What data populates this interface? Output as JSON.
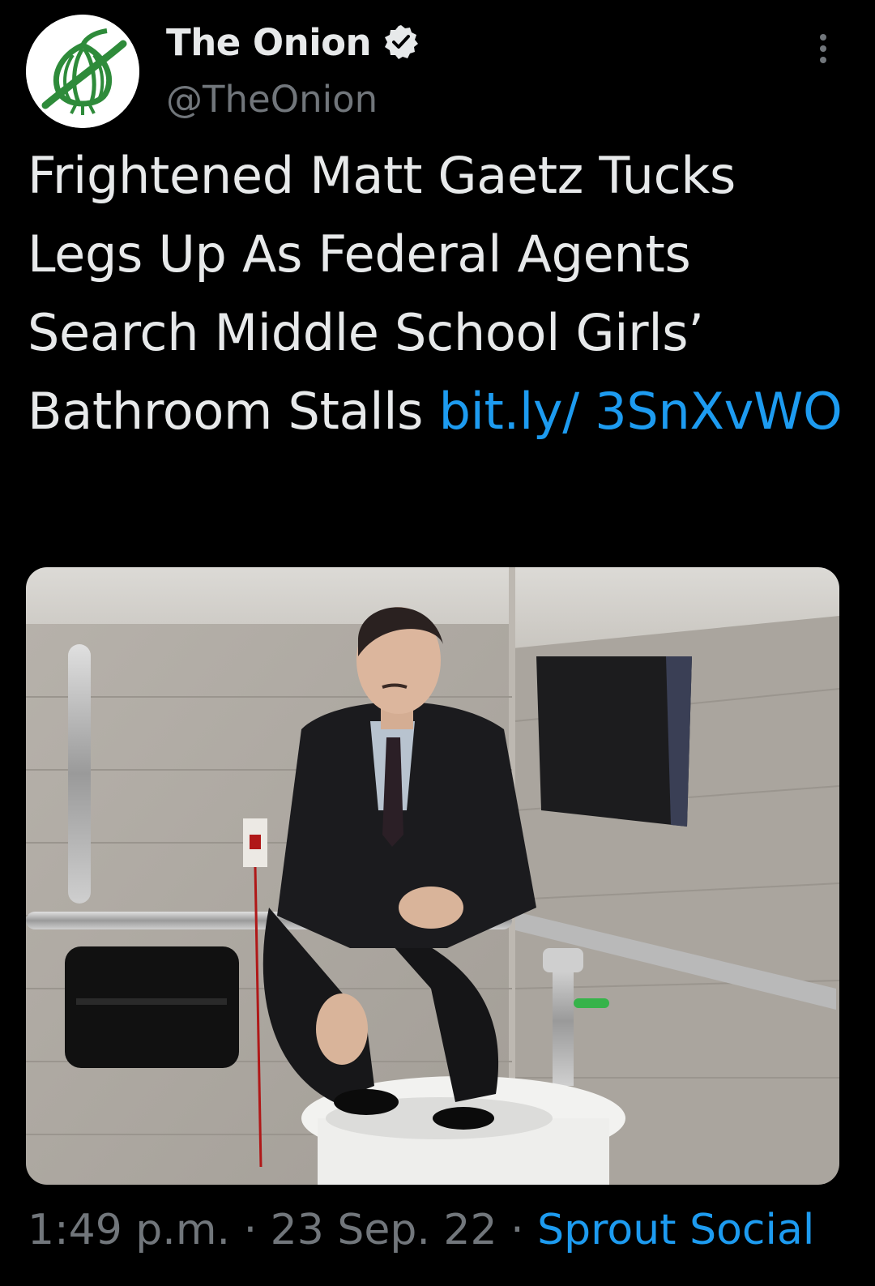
{
  "account": {
    "display_name": "The Onion",
    "handle": "@TheOnion",
    "verified": true,
    "avatar_icon": "onion-logo-icon"
  },
  "tweet": {
    "text": "Frightened Matt Gaetz Tucks Legs Up As Federal Agents Search Middle School Girls’ Bathroom Stalls ",
    "link_text": "bit.ly/ 3SnXvWO"
  },
  "meta": {
    "time": "1:49 p.m.",
    "separator": "·",
    "date": "23 Sep. 22",
    "source": "Sprout Social"
  },
  "colors": {
    "background": "#000000",
    "text": "#e7e9ea",
    "secondary": "#71767b",
    "link": "#1d9bf0",
    "onion_green": "#2e8b3a"
  }
}
